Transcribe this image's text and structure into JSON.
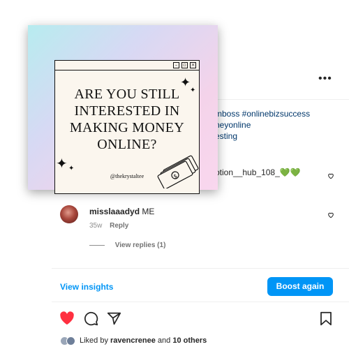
{
  "post": {
    "image": {
      "line1": "ARE YOU STILL",
      "line2": "INTERESTED IN",
      "line3": "MAKING MONEY",
      "line4": "ONLINE?",
      "handle": "@thekrystaltee"
    },
    "caption_lines": [
      "mboss #onlinebizsuccess",
      "neyonline",
      "esting"
    ],
    "partial_comment": "otion__hub_108_💚💚"
  },
  "comment": {
    "username": "misslaaadyd",
    "text": "ME",
    "age": "35w",
    "reply_label": "Reply",
    "view_replies": "View replies (1)"
  },
  "insights": {
    "view_label": "View insights",
    "boost_label": "Boost again"
  },
  "likes": {
    "prefix": "Liked by ",
    "user": "ravencrenee",
    "middle": " and ",
    "others": "10 others"
  },
  "colors": {
    "accent": "#0095f6",
    "like": "#ff3040",
    "link_text": "#00376b"
  },
  "icons": [
    "more-icon",
    "heart-icon",
    "comment-icon",
    "share-icon",
    "bookmark-icon"
  ]
}
